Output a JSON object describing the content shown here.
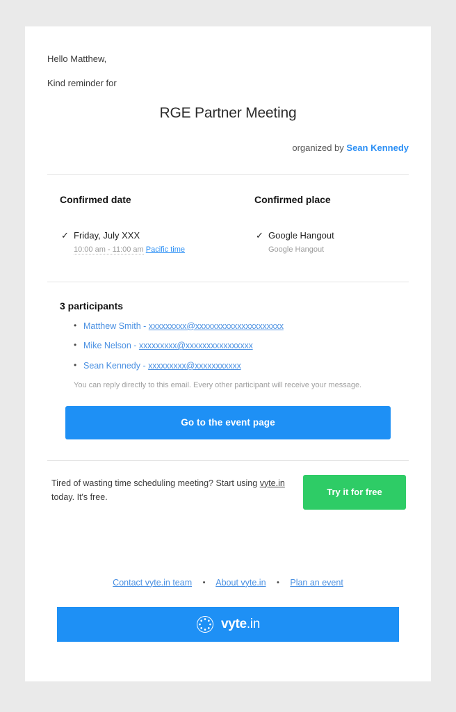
{
  "greeting": "Hello Matthew,",
  "reminder_intro": "Kind reminder for",
  "event_title": "RGE Partner Meeting",
  "organized_by": {
    "prefix": "organized by ",
    "organizer": "Sean Kennedy"
  },
  "date_column": {
    "heading": "Confirmed date",
    "check_glyph": "✓",
    "value": "Friday, July XXX",
    "time_range": "10:00 am - 11:00 am",
    "timezone_link": "Pacific time"
  },
  "place_column": {
    "heading": "Confirmed place",
    "check_glyph": "✓",
    "value": "Google Hangout",
    "sub_value": "Google Hangout"
  },
  "participants": {
    "heading": "3 participants",
    "list": [
      {
        "name": "Matthew Smith",
        "separator": " - ",
        "email": "xxxxxxxxx@xxxxxxxxxxxxxxxxxxxxx"
      },
      {
        "name": "Mike Nelson",
        "separator": " - ",
        "email": "xxxxxxxxx@xxxxxxxxxxxxxxxx "
      },
      {
        "name": "Sean Kennedy",
        "separator": " - ",
        "email": "xxxxxxxxx@xxxxxxxxxxx"
      }
    ],
    "reply_note": "You can reply directly to this email. Every other participant will receive your message."
  },
  "primary_cta": "Go to the event page",
  "promo": {
    "text_part_1": "Tired of wasting time scheduling meeting? Start using ",
    "link": "vyte.in",
    "text_part_2": " today. It's free.",
    "button": "Try it for free"
  },
  "footer": {
    "links": [
      "Contact vyte.in team",
      "About vyte.in",
      "Plan an event"
    ],
    "separator": "•"
  },
  "logo": {
    "icon": "vyte-circle-dots-icon",
    "name_bold": "vyte",
    "name_rest": ".in"
  },
  "colors": {
    "accent_blue": "#1e90f5",
    "link_blue": "#4a90e2",
    "accent_green": "#2ecc66",
    "page_background": "#eaeaea",
    "card_background": "#ffffff"
  }
}
